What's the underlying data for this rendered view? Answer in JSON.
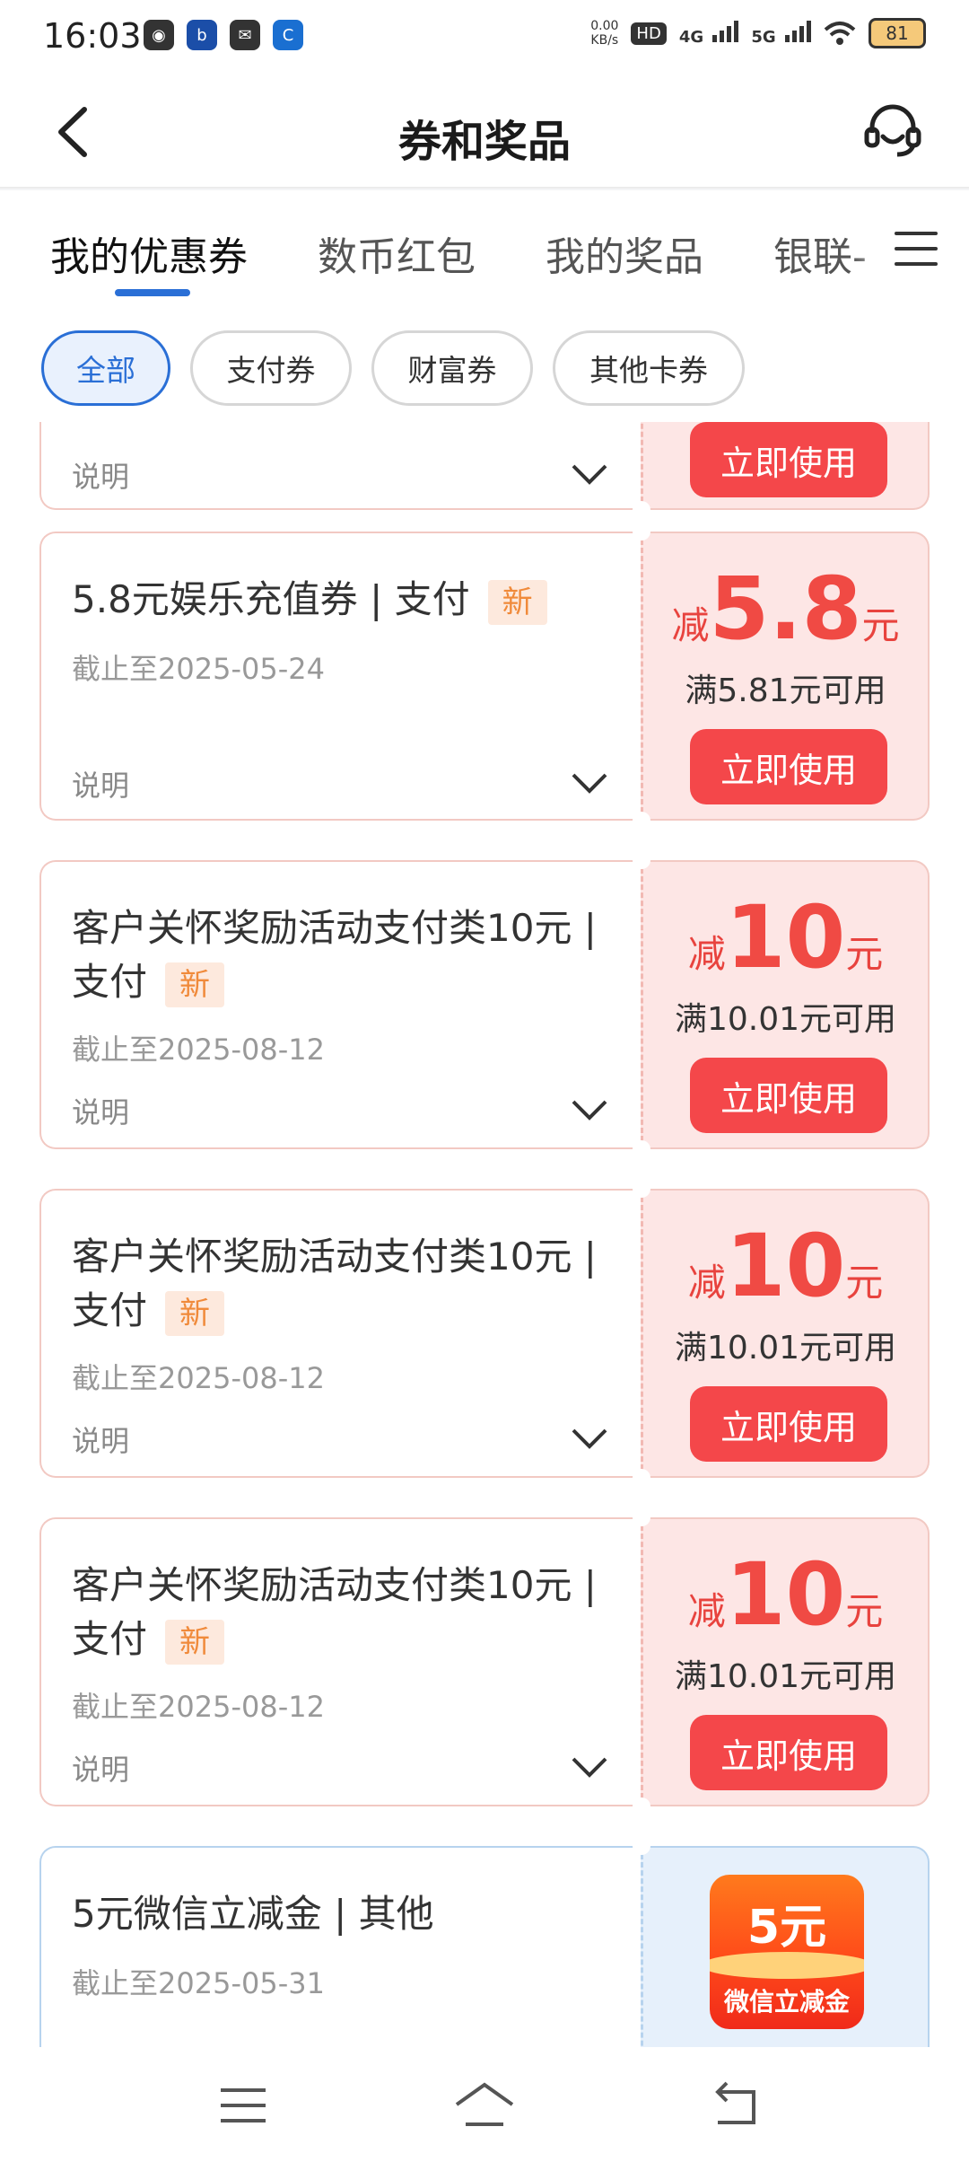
{
  "status_bar": {
    "time": "16:03",
    "net_speed_value": "0.00",
    "net_speed_unit": "KB/s",
    "hd_label": "HD",
    "network_1": "4G",
    "network_2": "5G",
    "battery": "81",
    "app_icons": [
      "wechat-icon",
      "app-icon",
      "message-icon",
      "bank-app-icon"
    ]
  },
  "header": {
    "title": "券和奖品"
  },
  "tabs": [
    {
      "label": "我的优惠券",
      "active": true
    },
    {
      "label": "数币红包",
      "active": false
    },
    {
      "label": "我的奖品",
      "active": false
    },
    {
      "label": "银联-",
      "active": false
    }
  ],
  "filters": [
    {
      "label": "全部",
      "active": true
    },
    {
      "label": "支付券",
      "active": false
    },
    {
      "label": "财富券",
      "active": false
    },
    {
      "label": "其他卡券",
      "active": false
    }
  ],
  "partial_coupon": {
    "desc_label": "说明",
    "button_label": "立即使用"
  },
  "coupons": [
    {
      "title": "5.8元娱乐充值券 | 支付",
      "badge": "新",
      "expiry": "截止至2025-05-24",
      "desc_label": "说明",
      "amount_prefix": "减",
      "amount": "5.8",
      "amount_unit": "元",
      "condition": "满5.81元可用",
      "button_label": "立即使用"
    },
    {
      "title": "客户关怀奖励活动支付类10元 | 支付",
      "badge": "新",
      "expiry": "截止至2025-08-12",
      "desc_label": "说明",
      "amount_prefix": "减",
      "amount": "10",
      "amount_unit": "元",
      "condition": "满10.01元可用",
      "button_label": "立即使用"
    },
    {
      "title": "客户关怀奖励活动支付类10元 | 支付",
      "badge": "新",
      "expiry": "截止至2025-08-12",
      "desc_label": "说明",
      "amount_prefix": "减",
      "amount": "10",
      "amount_unit": "元",
      "condition": "满10.01元可用",
      "button_label": "立即使用"
    },
    {
      "title": "客户关怀奖励活动支付类10元 | 支付",
      "badge": "新",
      "expiry": "截止至2025-08-12",
      "desc_label": "说明",
      "amount_prefix": "减",
      "amount": "10",
      "amount_unit": "元",
      "condition": "满10.01元可用",
      "button_label": "立即使用"
    }
  ],
  "wechat_coupon": {
    "title": "5元微信立减金 | 其他",
    "expiry": "截止至2025-05-31",
    "badge_amount": "5元",
    "badge_text": "微信立减金"
  },
  "colors": {
    "accent_blue": "#2a6fd6",
    "coupon_red": "#f04a44",
    "button_red": "#f4474a",
    "new_badge_orange": "#f08a3a"
  },
  "nav_bar": {
    "icons": [
      "menu-icon",
      "home-icon",
      "back-icon"
    ]
  }
}
